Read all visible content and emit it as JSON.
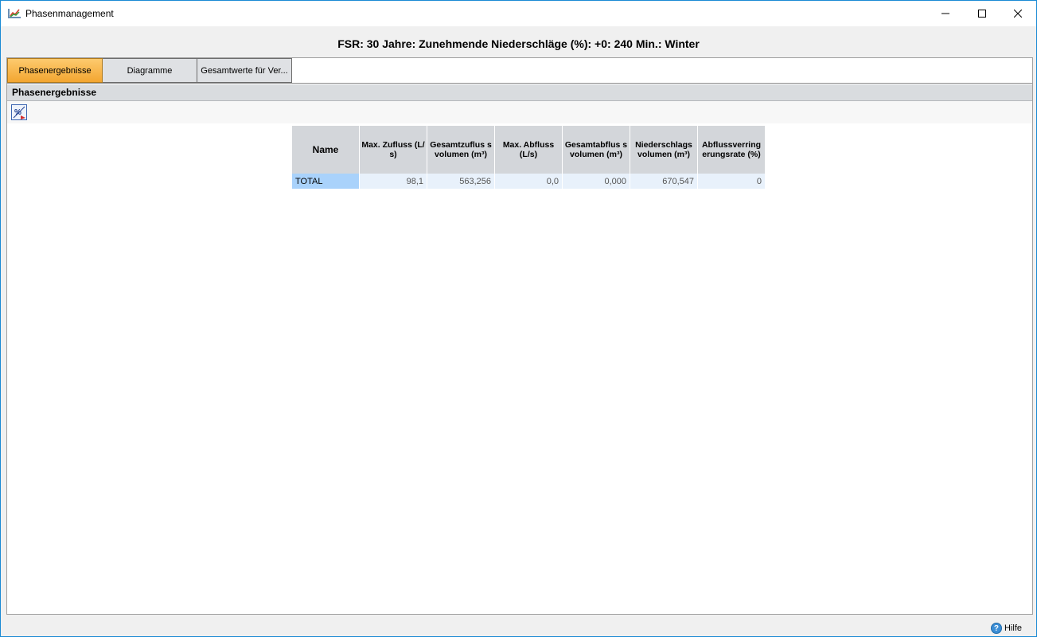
{
  "window": {
    "title": "Phasenmanagement",
    "icon": "chart-app-icon"
  },
  "heading": "FSR: 30 Jahre: Zunehmende Niederschläge (%): +0: 240 Min.: Winter",
  "tabs": [
    {
      "label": "Phasenergebnisse",
      "active": true
    },
    {
      "label": "Diagramme",
      "active": false
    },
    {
      "label": "Gesamtwerte für Ver...",
      "active": false
    }
  ],
  "section": {
    "title": "Phasenergebnisse"
  },
  "toolbar": {
    "icon": "percent-toggle-icon"
  },
  "table": {
    "headers": [
      "Name",
      "Max. Zufluss (L/s)",
      "Gesamtzuflus svolumen (m³)",
      "Max. Abfluss (L/s)",
      "Gesamtabflus svolumen (m³)",
      "Niederschlags volumen (m³)",
      "Abflussverring erungsrate (%)"
    ],
    "rows": [
      [
        "TOTAL",
        "98,1",
        "563,256",
        "0,0",
        "0,000",
        "670,547",
        "0"
      ]
    ]
  },
  "status": {
    "help_label": "Hilfe"
  },
  "colors": {
    "active_tab": "#f3a631",
    "selected_cell": "#a9d2fb",
    "window_border": "#1a8ad4"
  }
}
